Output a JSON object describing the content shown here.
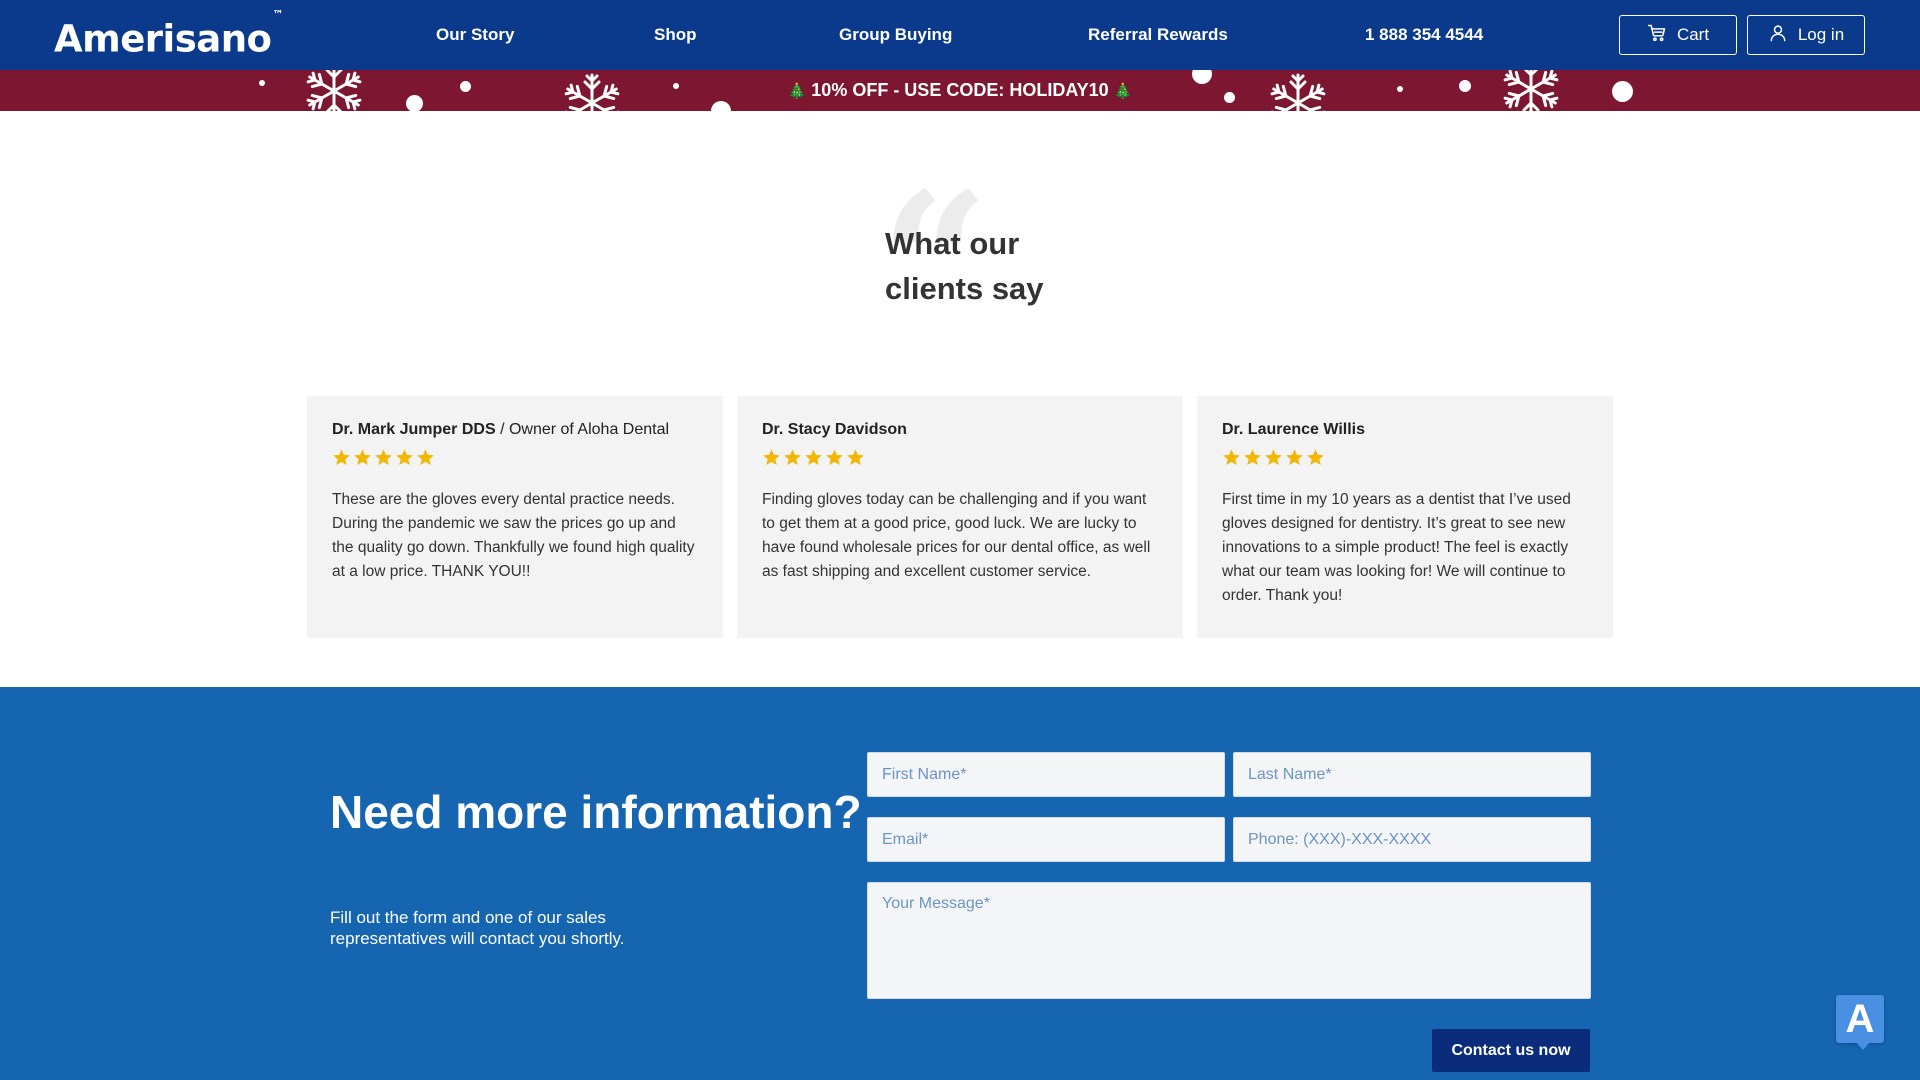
{
  "header": {
    "logo": "Amerisano",
    "logo_mark": "™",
    "nav": [
      "Our Story",
      "Shop",
      "Group Buying",
      "Referral Rewards",
      "1 888 354 4544"
    ],
    "cart_label": "Cart",
    "login_label": "Log in",
    "cart_icon": "cart-icon",
    "login_icon": "user-icon"
  },
  "promo": {
    "text": "10% OFF - USE CODE: HOLIDAY10",
    "icon": "christmas-tree-icon",
    "tree_glyph": "🎄"
  },
  "testimonials": {
    "title": "What our clients say",
    "quote_glyph": "“",
    "cards": [
      {
        "name": "Dr. Mark Jumper DDS",
        "role": "/ Owner of Aloha Dental",
        "rating": 5,
        "text": "These are the gloves every dental practice needs. During the pandemic we saw the prices go up and the quality go down. Thankfully we found high quality at a low price. THANK YOU!!"
      },
      {
        "name": "Dr. Stacy Davidson",
        "role": "",
        "rating": 5,
        "text": "Finding gloves today can be challenging and if you want to get them at a good price, good luck. We are lucky to have found wholesale prices for our dental office, as well as fast shipping and excellent customer service."
      },
      {
        "name": "Dr. Laurence Willis",
        "role": "",
        "rating": 5,
        "text": "First time in my 10 years as a dentist that I’ve used gloves designed for dentistry. It’s great to see new innovations to a simple product! The feel is exactly what our team was looking for! We will continue to order. Thank you!"
      }
    ],
    "star_color": "#f2b705"
  },
  "contact": {
    "title": "Need more information?",
    "subtitle": "Fill out the form and one of our sales representatives will contact you shortly.",
    "first_name_placeholder": "First Name*",
    "last_name_placeholder": "Last Name*",
    "email_placeholder": "Email*",
    "phone_placeholder": "Phone: (XXX)-XXX-XXXX",
    "message_placeholder": "Your Message*",
    "submit_label": "Contact us now"
  },
  "accessibility_badge": {
    "label": "A"
  },
  "colors": {
    "header": "#0b3a8c",
    "promo": "#7d1630",
    "contact_bg": "#1565b0",
    "submit": "#0b2c7a"
  }
}
